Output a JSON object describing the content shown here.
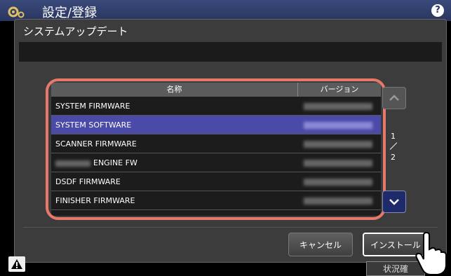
{
  "header": {
    "title": "設定/登録",
    "help_label": "?"
  },
  "dialog": {
    "title": "システムアップデート",
    "table": {
      "columns": [
        "名称",
        "バージョン"
      ],
      "rows": [
        {
          "name": "SYSTEM FIRMWARE",
          "selected": false
        },
        {
          "name": "SYSTEM SOFTWARE",
          "selected": true
        },
        {
          "name": "SCANNER FIRMWARE",
          "selected": false
        },
        {
          "name": "ENGINE FW",
          "selected": false
        },
        {
          "name": "DSDF FIRMWARE",
          "selected": false
        },
        {
          "name": "FINISHER FIRMWARE",
          "selected": false
        }
      ]
    },
    "page": {
      "current": "1",
      "total": "2"
    },
    "buttons": {
      "cancel": "キャンセル",
      "install": "インストール"
    }
  },
  "footer": {
    "status_label": "状況確"
  },
  "colors": {
    "highlight": "#e8786a",
    "selected_row": "#4a4aa8",
    "header_bar": "#2a3560"
  }
}
